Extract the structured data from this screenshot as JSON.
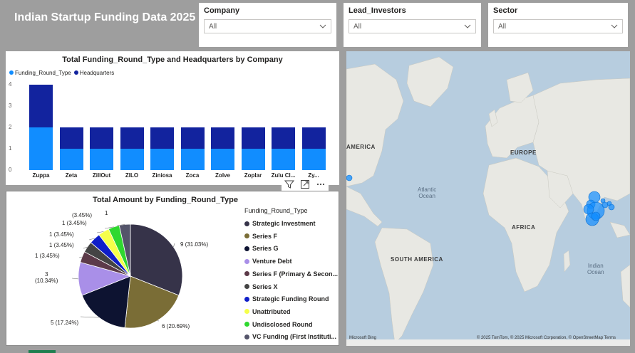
{
  "header": {
    "title": "Indian Startup Funding Data 2025"
  },
  "slicers": [
    {
      "label": "Company",
      "value": "All"
    },
    {
      "label": "Lead_Investors",
      "value": "All"
    },
    {
      "label": "Sector",
      "value": "All"
    }
  ],
  "bar_chart": {
    "title": "Total Funding_Round_Type and Headquarters by Company",
    "legend": [
      {
        "name": "Funding_Round_Type",
        "color": "#118dff"
      },
      {
        "name": "Headquarters",
        "color": "#12239e"
      }
    ],
    "y_ticks": [
      "0",
      "1",
      "2",
      "3",
      "4"
    ]
  },
  "pie_chart": {
    "title": "Total Amount by Funding_Round_Type",
    "legend_title": "Funding_Round_Type"
  },
  "chart_data": [
    {
      "type": "bar",
      "title": "Total Funding_Round_Type and Headquarters by Company",
      "categories": [
        "Zuppa",
        "Zeta",
        "ZillOut",
        "ZILO",
        "Ziniosa",
        "Zoca",
        "Zolve",
        "Zoplar",
        "Zulu Cl...",
        "Zy..."
      ],
      "series": [
        {
          "name": "Funding_Round_Type",
          "values": [
            2,
            1,
            1,
            1,
            1,
            1,
            1,
            1,
            1,
            1
          ],
          "color": "#118dff"
        },
        {
          "name": "Headquarters",
          "values": [
            2,
            1,
            1,
            1,
            1,
            1,
            1,
            1,
            1,
            1
          ],
          "color": "#12239e"
        }
      ],
      "stacked": true,
      "ylim": [
        0,
        4
      ],
      "legend_position": "top-left"
    },
    {
      "type": "pie",
      "title": "Total Amount by Funding_Round_Type",
      "slices": [
        {
          "name": "Strategic Investment",
          "value": 9,
          "label": "9 (31.03%)",
          "color": "#363349"
        },
        {
          "name": "Series F",
          "value": 6,
          "label": "6 (20.69%)",
          "color": "#7a6d36"
        },
        {
          "name": "Series G",
          "value": 5,
          "label": "5 (17.24%)",
          "color": "#0d1331"
        },
        {
          "name": "Venture Debt",
          "value": 3,
          "label": "3 (10.34%)",
          "color": "#a98fe8"
        },
        {
          "name": "Series F (Primary & Secon...",
          "value": 1,
          "label": "1 (3.45%)",
          "color": "#5c3a49"
        },
        {
          "name": "Series X",
          "value": 1,
          "label": "1 (3.45%)",
          "color": "#444444"
        },
        {
          "name": "Strategic Funding Round",
          "value": 1,
          "label": "1 (3.45%)",
          "color": "#0f1ec8"
        },
        {
          "name": "Unattributed",
          "value": 1,
          "label": "1 (3.45%)",
          "color": "#f5ff4a"
        },
        {
          "name": "Undisclosed Round",
          "value": 1,
          "label": "1 (3.45%)",
          "color": "#2fd82f"
        },
        {
          "name": "VC Funding (First Instituti...",
          "value": 1,
          "label": "1",
          "color": "#54546a"
        }
      ],
      "legend_position": "right"
    }
  ],
  "map": {
    "labels": {
      "america": "AMERICA",
      "europe": "EUROPE",
      "africa": "AFRICA",
      "south_america": "SOUTH AMERICA",
      "atlantic": "Atlantic",
      "atlantic2": "Ocean",
      "indian": "Indian",
      "indian2": "Ocean"
    },
    "attribution": "© 2025 TomTom, © 2025 Microsoft Corporation, © OpenStreetMap  Terms",
    "bing": "Microsoft Bing"
  },
  "colors": {
    "bubble": "#118dff"
  }
}
